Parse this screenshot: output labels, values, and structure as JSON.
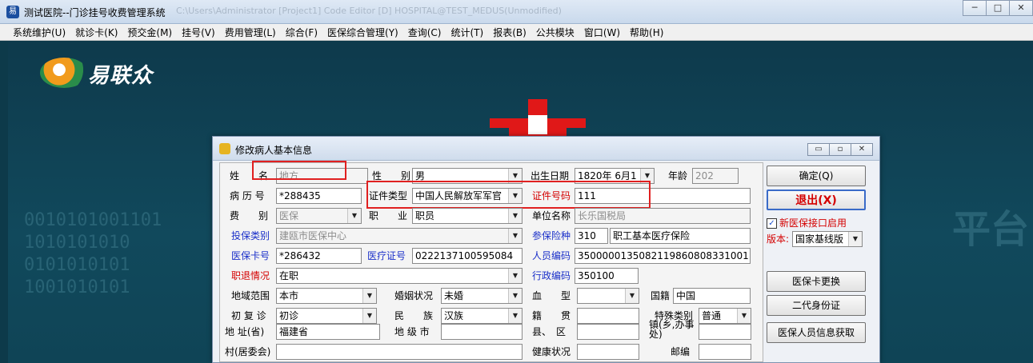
{
  "window": {
    "title": "测试医院--门诊挂号收费管理系统",
    "ghost_text": "C:\\Users\\Administrator     [Project1]     Code Editor     [D]  HOSPITAL@TEST_MEDUS(Unmodified)",
    "btn_min": "─",
    "btn_max": "□",
    "btn_close": "✕"
  },
  "menu": [
    "系统维护(U)",
    "就诊卡(K)",
    "预交金(M)",
    "挂号(V)",
    "费用管理(L)",
    "综合(F)",
    "医保综合管理(Y)",
    "查询(C)",
    "统计(T)",
    "报表(B)",
    "公共模块",
    "窗口(W)",
    "帮助(H)"
  ],
  "desktop": {
    "logo_text": "易联众",
    "binary_lines": [
      "0010101001101",
      "1010101010",
      "0101010101",
      "1001010101"
    ],
    "watermark": "平台"
  },
  "dialog": {
    "title": "修改病人基本信息",
    "btn_min": "▭",
    "btn_max": "▫",
    "btn_close": "✕"
  },
  "form": {
    "name_label": "姓　　名",
    "name_value": "地方",
    "gender_label": "性　　别",
    "gender_value": "男",
    "birth_label": "出生日期",
    "birth_value": "1820年 6月1",
    "age_label": "年龄",
    "age_value": "202",
    "record_label": "病 历 号",
    "record_value": "*288435",
    "idtype_label": "证件类型",
    "idtype_value": "中国人民解放军军官",
    "idno_label": "证件号码",
    "idno_value": "111",
    "fee_label": "费　　别",
    "fee_value": "医保",
    "job_label": "职　　业",
    "job_value": "职员",
    "unit_label": "单位名称",
    "unit_value": "长乐国税局",
    "instype_label": "投保类别",
    "instype_value": "建瓯市医保中心",
    "insured_label": "参保险种",
    "insured_code": "310",
    "insured_name": "职工基本医疗保险",
    "mcard_label": "医保卡号",
    "mcard_value": "*286432",
    "mcert_label": "医疗证号",
    "mcert_value": "0222137100595084",
    "pcode_label": "人员编码",
    "pcode_value": "35000001350821198608083310​01",
    "retire_label": "职退情况",
    "retire_value": "在职",
    "admin_label": "行政编码",
    "admin_value": "350100",
    "region_label": "地域范围",
    "region_value": "本市",
    "marital_label": "婚姻状况",
    "marital_value": "未婚",
    "blood_label": "血　　型",
    "blood_value": "",
    "nation_label": "国籍",
    "nation_value": "中国",
    "visit_label": "初 复 诊",
    "visit_value": "初诊",
    "ethnic_label": "民　　族",
    "ethnic_value": "汉族",
    "native_label": "籍　　贯",
    "native_value": "",
    "special_label": "特殊类别",
    "special_value": "普通",
    "addr_label": "地 址(省)",
    "addr_value": "福建省",
    "city_label": "地 级 市",
    "city_value": "",
    "county_label": "县、　区",
    "county_value": "",
    "town_label": "镇(乡,办事处)",
    "town_value": "",
    "village_label": "村(居委会)",
    "village_value": "",
    "health_label": "健康状况",
    "health_value": "",
    "postal_label": "邮编",
    "postal_value": ""
  },
  "side": {
    "confirm": "确定(Q)",
    "exit": "退出(X)",
    "new_insurance_label": "新医保接口启用",
    "new_insurance_checked": "✓",
    "version_label": "版本:",
    "version_value": "国家基线版",
    "card_change": "医保卡更换",
    "id_card2": "二代身份证",
    "insurance_info": "医保人员信息获取"
  },
  "icons": {
    "dropdown": "▼"
  }
}
